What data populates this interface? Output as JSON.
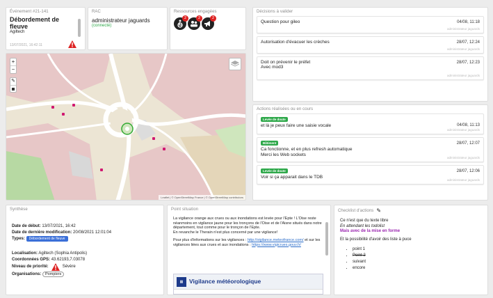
{
  "event": {
    "title": "Événement #21-141",
    "name": "Débordement de fleuve",
    "org": "Agiltech",
    "date": "13/07/2021, 16:42:11"
  },
  "rac": {
    "title": "RAC",
    "user": "administrateur jaguards",
    "status": "(connecté)"
  },
  "resources": {
    "title": "Ressources engagées",
    "items": [
      {
        "icon": "wheelchair-icon",
        "count": "2"
      },
      {
        "icon": "people-icon",
        "count": "2"
      },
      {
        "icon": "megaphone-icon",
        "count": "2"
      }
    ]
  },
  "decisions": {
    "title": "Décisions à valider",
    "items": [
      {
        "text": "Question pour gileo",
        "when": "04/08, 11:18",
        "who": "administrateur jaguards"
      },
      {
        "text": "Autorisation d'évacuer les crèches",
        "when": "28/07, 12:24",
        "who": "administrateur jaguards"
      },
      {
        "text": "Doit on prévenir le préfet\nAvec mod3",
        "when": "28/07, 12:23",
        "who": "administrateur jaguards"
      }
    ]
  },
  "actions": {
    "title": "Actions réalisées ou en cours",
    "items": [
      {
        "badge": "Levée de doute",
        "text": "et là je peux faire une saisie vocale",
        "when": "04/08, 11:13",
        "who": "administrateur jaguards"
      },
      {
        "badge": "Bâtiment",
        "text": "Ca fonctionne, et en plus refresh automatique\nMerci les Web sockets",
        "when": "28/07, 12:07",
        "who": "administrateur jaguards"
      },
      {
        "badge": "Levée de doute",
        "text": "Voir si ça apparait dans le TDB",
        "when": "28/07, 12:06",
        "who": "administrateur jaguards"
      }
    ]
  },
  "map": {
    "zoom_in": "+",
    "zoom_out": "−",
    "attribution": "Leaflet | © OpenStreetMap France | © OpenStreetMap contributors"
  },
  "synthese": {
    "title": "Synthèse",
    "start_label": "Date de début:",
    "start": "13/07/2021, 16:42",
    "modif_label": "Date de dernière modification:",
    "modif": "20/08/2021 12:01:04",
    "types_label": "Types:",
    "type_badge": "Débordement de fleuve",
    "loc_label": "Localisation:",
    "loc": "Agiltech (Sophia Antipolis)",
    "gps_label": "Coordonnées GPS:",
    "gps": "43.62193,7.03078",
    "prio_label": "Niveau de priorité:",
    "prio": "Sévère",
    "orgs_label": "Organisations:",
    "org_badge": "Pompiers"
  },
  "point": {
    "title": "Point situation",
    "p1": "La vigilance orange aux crues ou aux inondations est levée pour l'Epte ! L'Oise reste néanmoins en vigilance jaune pour les tronçons de l'Oise et de l'Aisne situés dans notre département, tout comme pour le tronçon de l'Epte.",
    "p1b": "En revanche le Therain n'est plus concerné par une vigilance!",
    "p2": "Pour plus d'informations sur les vigilances :",
    "link1": "http://vigilance.meteofrance.com/",
    "p3": "et sur les vigilances liées aux crues et aux inondations :",
    "link2": "https://www.vigicrues.gouv.fr/",
    "banner": "Vigilance météorologique"
  },
  "checklist": {
    "title": "Checklist d'actions",
    "l1": "Ce n'est que du texte libre",
    "l2": "En attendant les todolist",
    "l3": "Mais avec de la mise en forme",
    "l4": "Et la possibilité d'avoir des liste à puce",
    "items": [
      "point 1",
      "Point 2",
      "suivant",
      "encore"
    ]
  }
}
